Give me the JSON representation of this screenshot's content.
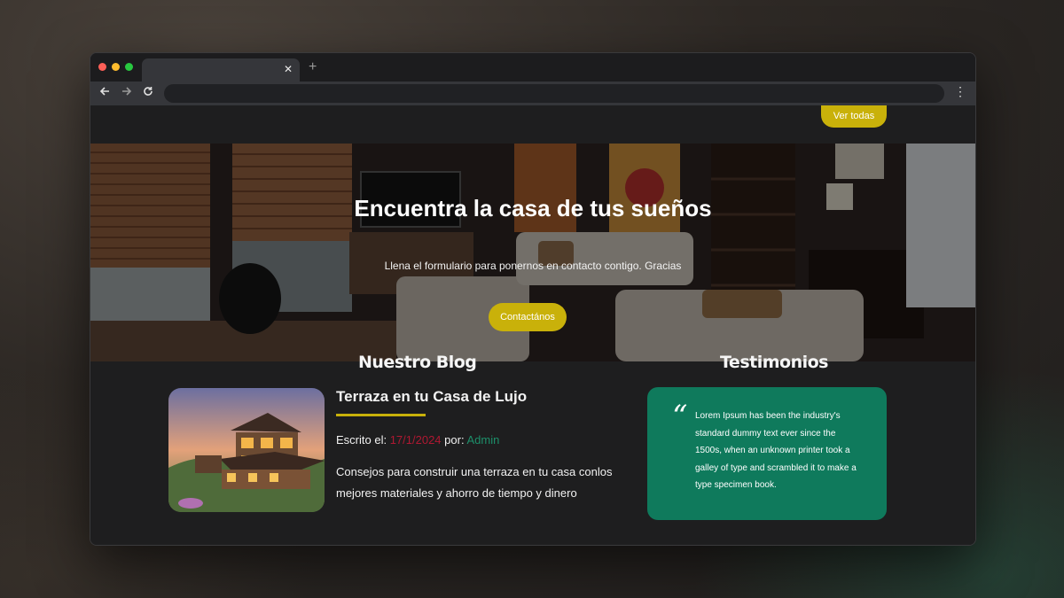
{
  "browser": {
    "tab_close_icon": "close-icon",
    "new_tab_icon": "plus-icon",
    "back_icon": "arrow-left-icon",
    "forward_icon": "arrow-right-icon",
    "reload_icon": "reload-icon",
    "menu_icon": "kebab-menu-icon",
    "url": ""
  },
  "header": {
    "ver_todas_label": "Ver todas"
  },
  "hero": {
    "title": "Encuentra la casa de tus sueños",
    "subtitle": "Llena el formulario para ponernos en contacto contigo. Gracias",
    "button_label": "Contactános"
  },
  "blog": {
    "heading": "Nuestro Blog",
    "post": {
      "title": "Terraza en tu Casa de Lujo",
      "written_label": "Escrito el:",
      "date": "17/1/2024",
      "by_label": "por:",
      "author": "Admin",
      "excerpt": "Consejos para construir una terraza en tu casa conlos mejores materiales y ahorro de tiempo y dinero"
    }
  },
  "testimonials": {
    "heading": "Testimonios",
    "quote_icon": "quote-icon",
    "text": "Lorem Ipsum has been the industry's standard dummy text ever since the 1500s, when an unknown printer took a galley of type and scrambled it to make a type specimen book."
  },
  "colors": {
    "accent_yellow": "#c9b10a",
    "date_red": "#b01832",
    "author_green": "#1d8f6a",
    "card_green": "#0f7a5c"
  }
}
